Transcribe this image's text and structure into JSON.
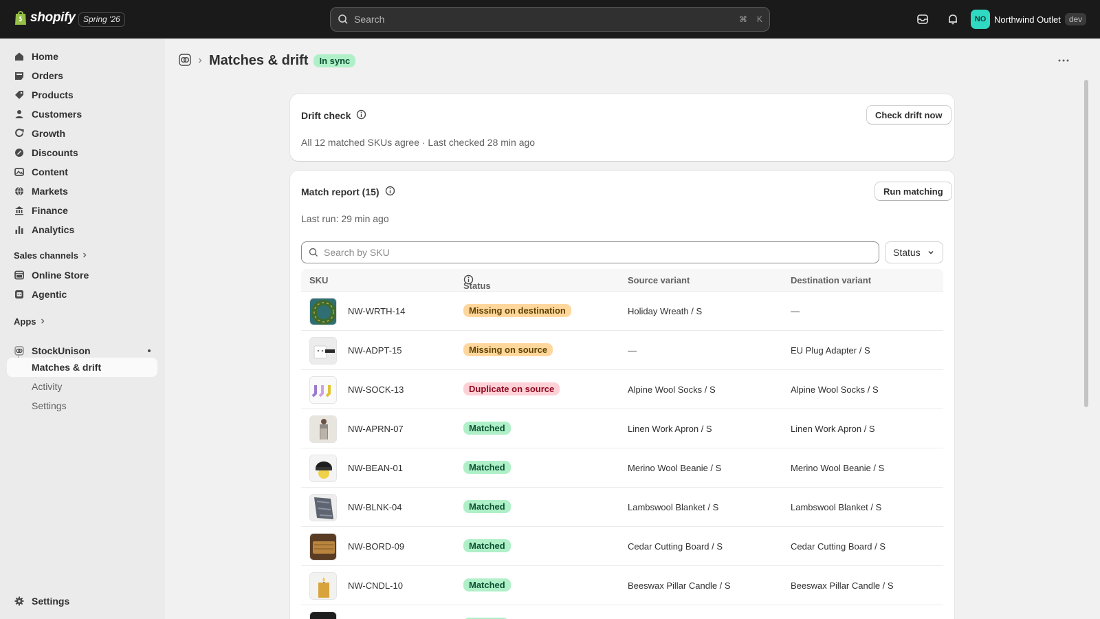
{
  "topbar": {
    "brand": "shopify",
    "edition": "Spring '26",
    "search_placeholder": "Search",
    "shortcut_cmd": "⌘",
    "shortcut_key": "K",
    "store_initials": "NO",
    "store_name": "Northwind Outlet",
    "store_env": "dev"
  },
  "sidebar": {
    "nav": [
      {
        "label": "Home",
        "icon": "home-icon"
      },
      {
        "label": "Orders",
        "icon": "orders-icon"
      },
      {
        "label": "Products",
        "icon": "tag-icon"
      },
      {
        "label": "Customers",
        "icon": "person-icon"
      },
      {
        "label": "Growth",
        "icon": "growth-icon"
      },
      {
        "label": "Discounts",
        "icon": "discount-icon"
      },
      {
        "label": "Content",
        "icon": "content-icon"
      },
      {
        "label": "Markets",
        "icon": "globe-icon"
      },
      {
        "label": "Finance",
        "icon": "bank-icon"
      },
      {
        "label": "Analytics",
        "icon": "chart-icon"
      }
    ],
    "sales_channels_label": "Sales channels",
    "channels": [
      {
        "label": "Online Store",
        "icon": "store-icon"
      },
      {
        "label": "Agentic",
        "icon": "agent-icon"
      }
    ],
    "apps_label": "Apps",
    "app": {
      "label": "StockUnison",
      "icon": "app-icon"
    },
    "app_subnav": [
      {
        "label": "Matches & drift",
        "active": true
      },
      {
        "label": "Activity",
        "active": false
      },
      {
        "label": "Settings",
        "active": false
      }
    ],
    "settings_label": "Settings"
  },
  "page": {
    "title": "Matches & drift",
    "status_badge": "In sync"
  },
  "drift_card": {
    "title": "Drift check",
    "button": "Check drift now",
    "summary": "All 12 matched SKUs agree · Last checked 28 min ago"
  },
  "report_card": {
    "title": "Match report (15)",
    "button": "Run matching",
    "last_run": "Last run: 29 min ago",
    "search_placeholder": "Search by SKU",
    "status_filter": "Status",
    "columns": {
      "sku": "SKU",
      "status": "Status",
      "source": "Source variant",
      "destination": "Destination variant"
    },
    "rows": [
      {
        "sku": "NW-WRTH-14",
        "status": "Missing on destination",
        "tone": "warn",
        "source": "Holiday Wreath / S",
        "destination": "—"
      },
      {
        "sku": "NW-ADPT-15",
        "status": "Missing on source",
        "tone": "warn",
        "source": "—",
        "destination": "EU Plug Adapter / S"
      },
      {
        "sku": "NW-SOCK-13",
        "status": "Duplicate on source",
        "tone": "crit",
        "source": "Alpine Wool Socks / S",
        "destination": "Alpine Wool Socks / S"
      },
      {
        "sku": "NW-APRN-07",
        "status": "Matched",
        "tone": "ok",
        "source": "Linen Work Apron / S",
        "destination": "Linen Work Apron / S"
      },
      {
        "sku": "NW-BEAN-01",
        "status": "Matched",
        "tone": "ok",
        "source": "Merino Wool Beanie / S",
        "destination": "Merino Wool Beanie / S"
      },
      {
        "sku": "NW-BLNK-04",
        "status": "Matched",
        "tone": "ok",
        "source": "Lambswool Blanket / S",
        "destination": "Lambswool Blanket / S"
      },
      {
        "sku": "NW-BORD-09",
        "status": "Matched",
        "tone": "ok",
        "source": "Cedar Cutting Board / S",
        "destination": "Cedar Cutting Board / S"
      },
      {
        "sku": "NW-CNDL-10",
        "status": "Matched",
        "tone": "ok",
        "source": "Beeswax Pillar Candle / S",
        "destination": "Beeswax Pillar Candle / S"
      }
    ]
  },
  "colors": {
    "topbar": "#1a1a1a",
    "canvas": "#f1f1f1",
    "sidebar": "#ebebeb",
    "success_badge": "#aff0c8",
    "warning_badge": "#ffd79d",
    "critical_badge": "#fed1d7",
    "avatar": "#2fd9c2"
  }
}
